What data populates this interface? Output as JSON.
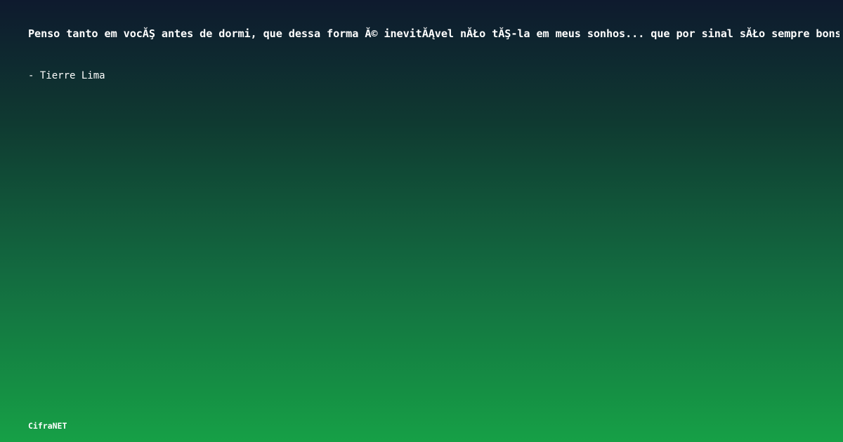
{
  "quote": {
    "text": "Penso tanto em vocĂŞ antes de dormi, que dessa forma Ă© inevitĂĄvel nĂŁo tĂŞ-la em meus sonhos... que por sinal sĂŁo sempre bons",
    "author": "- Tierre Lima"
  },
  "footer": {
    "brand": "CifraNET"
  },
  "colors": {
    "gradient_top": "#0e1a2e",
    "gradient_mid": "#136b40",
    "gradient_bottom": "#16a046",
    "text": "#ffffff"
  }
}
